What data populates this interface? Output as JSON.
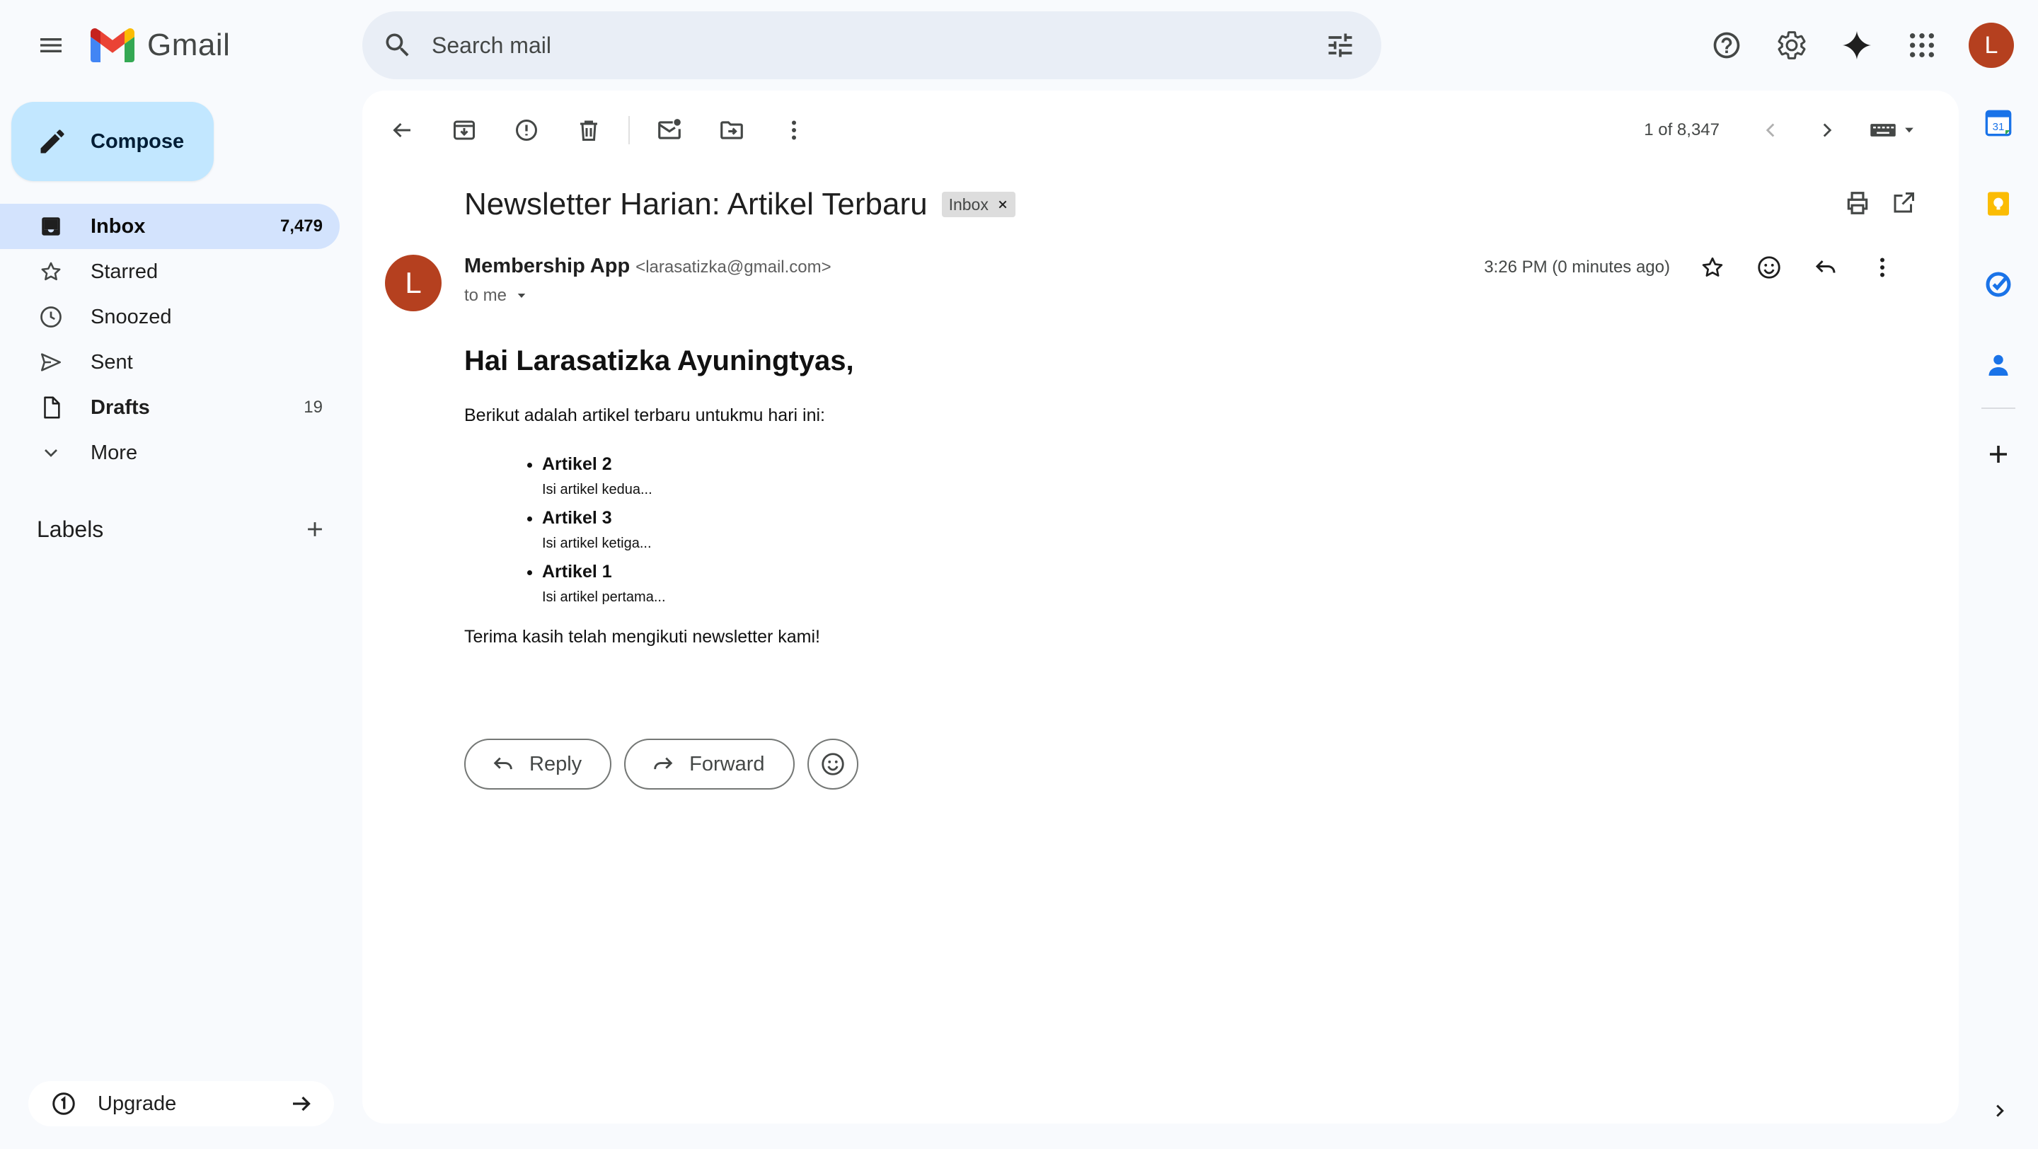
{
  "app": {
    "name": "Gmail"
  },
  "search": {
    "placeholder": "Search mail"
  },
  "account": {
    "avatar_letter": "L",
    "avatar_color": "#b5401f"
  },
  "sidebar": {
    "compose_label": "Compose",
    "items": [
      {
        "label": "Inbox",
        "count": "7,479",
        "icon": "inbox-icon"
      },
      {
        "label": "Starred",
        "count": "",
        "icon": "star-icon"
      },
      {
        "label": "Snoozed",
        "count": "",
        "icon": "clock-icon"
      },
      {
        "label": "Sent",
        "count": "",
        "icon": "send-icon"
      },
      {
        "label": "Drafts",
        "count": "19",
        "icon": "draft-icon"
      },
      {
        "label": "More",
        "count": "",
        "icon": "chevron-down-icon"
      }
    ],
    "labels_title": "Labels",
    "upgrade_label": "Upgrade"
  },
  "toolbar": {
    "pager_text": "1 of 8,347"
  },
  "email": {
    "subject": "Newsletter Harian: Artikel Terbaru",
    "label_chip": "Inbox",
    "sender_name": "Membership App",
    "sender_email": "<larasatizka@gmail.com>",
    "sender_initial": "L",
    "recipient": "to me",
    "time": "3:26 PM (0 minutes ago)",
    "body": {
      "greeting": "Hai Larasatizka Ayuningtyas,",
      "intro": "Berikut adalah artikel terbaru untukmu hari ini:",
      "articles": [
        {
          "title": "Artikel 2",
          "desc": "Isi artikel kedua..."
        },
        {
          "title": "Artikel 3",
          "desc": "Isi artikel ketiga..."
        },
        {
          "title": "Artikel 1",
          "desc": "Isi artikel pertama..."
        }
      ],
      "closing": "Terima kasih telah mengikuti newsletter kami!"
    },
    "reply_label": "Reply",
    "forward_label": "Forward"
  },
  "side_panel": {
    "calendar_day": "31",
    "colors": {
      "calendar": "#1a73e8",
      "keep": "#fbbc04",
      "tasks": "#1a73e8",
      "contacts": "#1a73e8"
    }
  }
}
